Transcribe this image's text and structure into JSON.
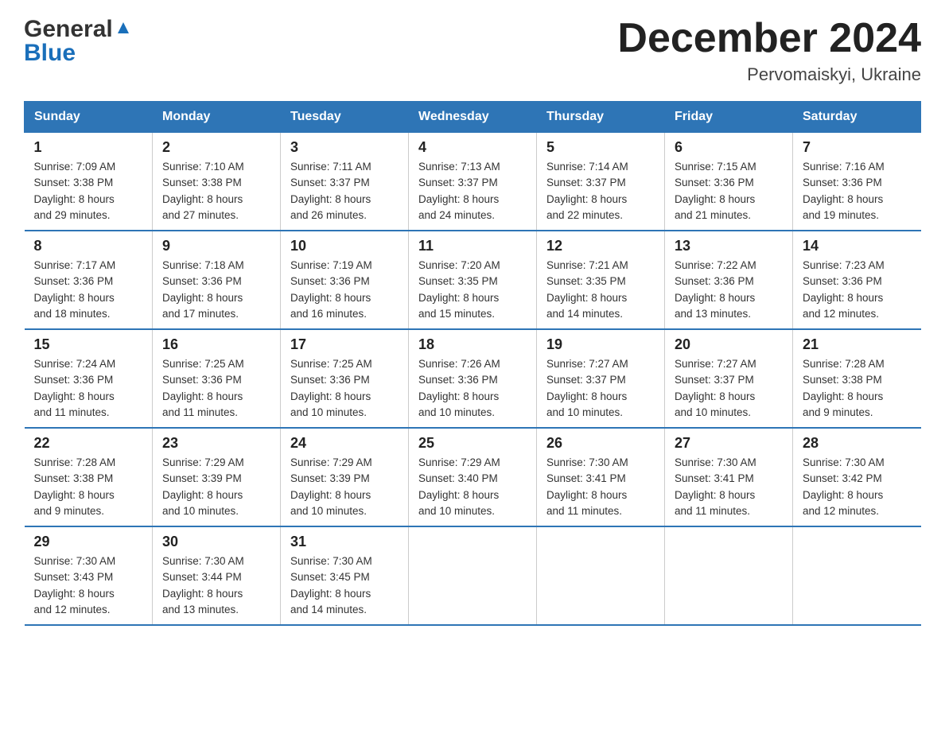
{
  "header": {
    "logo_line1": "General",
    "logo_line2": "Blue",
    "title": "December 2024",
    "subtitle": "Pervomaiskyi, Ukraine"
  },
  "calendar": {
    "days_of_week": [
      "Sunday",
      "Monday",
      "Tuesday",
      "Wednesday",
      "Thursday",
      "Friday",
      "Saturday"
    ],
    "weeks": [
      [
        {
          "day": "1",
          "sunrise": "7:09 AM",
          "sunset": "3:38 PM",
          "daylight": "8 hours and 29 minutes."
        },
        {
          "day": "2",
          "sunrise": "7:10 AM",
          "sunset": "3:38 PM",
          "daylight": "8 hours and 27 minutes."
        },
        {
          "day": "3",
          "sunrise": "7:11 AM",
          "sunset": "3:37 PM",
          "daylight": "8 hours and 26 minutes."
        },
        {
          "day": "4",
          "sunrise": "7:13 AM",
          "sunset": "3:37 PM",
          "daylight": "8 hours and 24 minutes."
        },
        {
          "day": "5",
          "sunrise": "7:14 AM",
          "sunset": "3:37 PM",
          "daylight": "8 hours and 22 minutes."
        },
        {
          "day": "6",
          "sunrise": "7:15 AM",
          "sunset": "3:36 PM",
          "daylight": "8 hours and 21 minutes."
        },
        {
          "day": "7",
          "sunrise": "7:16 AM",
          "sunset": "3:36 PM",
          "daylight": "8 hours and 19 minutes."
        }
      ],
      [
        {
          "day": "8",
          "sunrise": "7:17 AM",
          "sunset": "3:36 PM",
          "daylight": "8 hours and 18 minutes."
        },
        {
          "day": "9",
          "sunrise": "7:18 AM",
          "sunset": "3:36 PM",
          "daylight": "8 hours and 17 minutes."
        },
        {
          "day": "10",
          "sunrise": "7:19 AM",
          "sunset": "3:36 PM",
          "daylight": "8 hours and 16 minutes."
        },
        {
          "day": "11",
          "sunrise": "7:20 AM",
          "sunset": "3:35 PM",
          "daylight": "8 hours and 15 minutes."
        },
        {
          "day": "12",
          "sunrise": "7:21 AM",
          "sunset": "3:35 PM",
          "daylight": "8 hours and 14 minutes."
        },
        {
          "day": "13",
          "sunrise": "7:22 AM",
          "sunset": "3:36 PM",
          "daylight": "8 hours and 13 minutes."
        },
        {
          "day": "14",
          "sunrise": "7:23 AM",
          "sunset": "3:36 PM",
          "daylight": "8 hours and 12 minutes."
        }
      ],
      [
        {
          "day": "15",
          "sunrise": "7:24 AM",
          "sunset": "3:36 PM",
          "daylight": "8 hours and 11 minutes."
        },
        {
          "day": "16",
          "sunrise": "7:25 AM",
          "sunset": "3:36 PM",
          "daylight": "8 hours and 11 minutes."
        },
        {
          "day": "17",
          "sunrise": "7:25 AM",
          "sunset": "3:36 PM",
          "daylight": "8 hours and 10 minutes."
        },
        {
          "day": "18",
          "sunrise": "7:26 AM",
          "sunset": "3:36 PM",
          "daylight": "8 hours and 10 minutes."
        },
        {
          "day": "19",
          "sunrise": "7:27 AM",
          "sunset": "3:37 PM",
          "daylight": "8 hours and 10 minutes."
        },
        {
          "day": "20",
          "sunrise": "7:27 AM",
          "sunset": "3:37 PM",
          "daylight": "8 hours and 10 minutes."
        },
        {
          "day": "21",
          "sunrise": "7:28 AM",
          "sunset": "3:38 PM",
          "daylight": "8 hours and 9 minutes."
        }
      ],
      [
        {
          "day": "22",
          "sunrise": "7:28 AM",
          "sunset": "3:38 PM",
          "daylight": "8 hours and 9 minutes."
        },
        {
          "day": "23",
          "sunrise": "7:29 AM",
          "sunset": "3:39 PM",
          "daylight": "8 hours and 10 minutes."
        },
        {
          "day": "24",
          "sunrise": "7:29 AM",
          "sunset": "3:39 PM",
          "daylight": "8 hours and 10 minutes."
        },
        {
          "day": "25",
          "sunrise": "7:29 AM",
          "sunset": "3:40 PM",
          "daylight": "8 hours and 10 minutes."
        },
        {
          "day": "26",
          "sunrise": "7:30 AM",
          "sunset": "3:41 PM",
          "daylight": "8 hours and 11 minutes."
        },
        {
          "day": "27",
          "sunrise": "7:30 AM",
          "sunset": "3:41 PM",
          "daylight": "8 hours and 11 minutes."
        },
        {
          "day": "28",
          "sunrise": "7:30 AM",
          "sunset": "3:42 PM",
          "daylight": "8 hours and 12 minutes."
        }
      ],
      [
        {
          "day": "29",
          "sunrise": "7:30 AM",
          "sunset": "3:43 PM",
          "daylight": "8 hours and 12 minutes."
        },
        {
          "day": "30",
          "sunrise": "7:30 AM",
          "sunset": "3:44 PM",
          "daylight": "8 hours and 13 minutes."
        },
        {
          "day": "31",
          "sunrise": "7:30 AM",
          "sunset": "3:45 PM",
          "daylight": "8 hours and 14 minutes."
        },
        {
          "day": "",
          "sunrise": "",
          "sunset": "",
          "daylight": ""
        },
        {
          "day": "",
          "sunrise": "",
          "sunset": "",
          "daylight": ""
        },
        {
          "day": "",
          "sunrise": "",
          "sunset": "",
          "daylight": ""
        },
        {
          "day": "",
          "sunrise": "",
          "sunset": "",
          "daylight": ""
        }
      ]
    ],
    "labels": {
      "sunrise_prefix": "Sunrise: ",
      "sunset_prefix": "Sunset: ",
      "daylight_prefix": "Daylight: "
    }
  }
}
